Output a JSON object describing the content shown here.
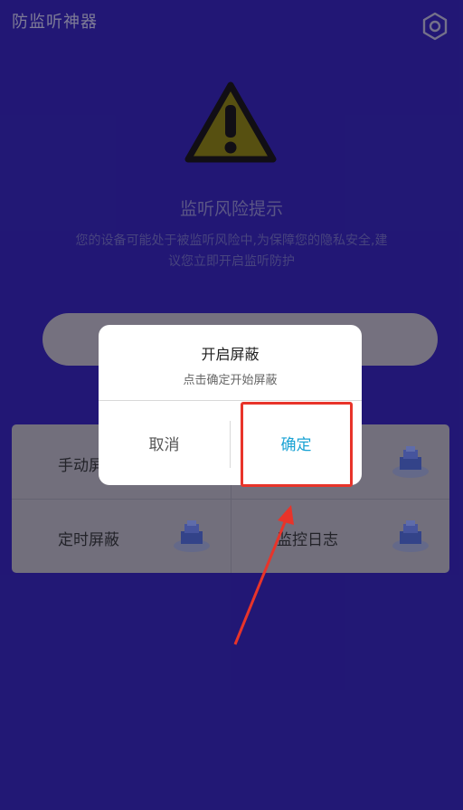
{
  "app": {
    "title": "防监听神器",
    "settings_icon": "hexagon-settings-icon"
  },
  "risk": {
    "icon": "warning-triangle-icon",
    "title": "监听风险提示",
    "description": "您的设备可能处于被监听风险中,为保障您的隐私安全,建议您立即开启监听防护"
  },
  "features": [
    {
      "label": "手动屏",
      "icon": "shield-box-icon"
    },
    {
      "label": "",
      "icon": "shield-box-icon"
    },
    {
      "label": "定时屏蔽",
      "icon": "shield-box-icon"
    },
    {
      "label": "监控日志",
      "icon": "shield-box-icon"
    }
  ],
  "dialog": {
    "title": "开启屏蔽",
    "message": "点击确定开始屏蔽",
    "cancel_label": "取消",
    "confirm_label": "确定"
  },
  "annotation": {
    "highlight_color": "#e8342a"
  },
  "colors": {
    "background": "#2a1d8f",
    "accent": "#1aa3d4"
  }
}
